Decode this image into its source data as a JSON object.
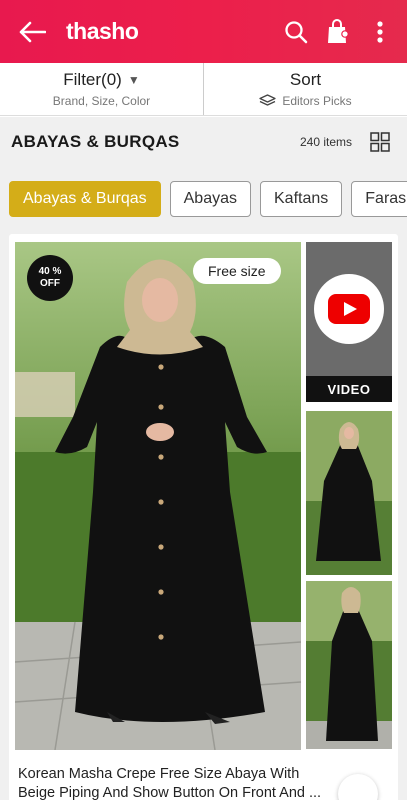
{
  "header": {
    "logo": "thasho",
    "icons": [
      "back-arrow-icon",
      "search-icon",
      "shopping-bag-icon",
      "more-vertical-icon"
    ]
  },
  "filter": {
    "label": "Filter(0)",
    "sub": "Brand, Size, Color"
  },
  "sort": {
    "label": "Sort",
    "sub": "Editors Picks"
  },
  "category": {
    "title": "ABAYAS & BURQAS",
    "count": "240 items"
  },
  "chips": [
    {
      "label": "Abayas & Burqas",
      "active": true
    },
    {
      "label": "Abayas",
      "active": false
    },
    {
      "label": "Kaftans",
      "active": false
    },
    {
      "label": "Farasha",
      "active": false
    }
  ],
  "product": {
    "discount_value": "40 %",
    "discount_label": "OFF",
    "size_tag": "Free size",
    "video_label": "VIDEO",
    "title": "Korean Masha Crepe Free Size Abaya With Beige Piping And Show Button On Front And ..."
  },
  "colors": {
    "brand": "#ec1f4b",
    "chip_active": "#d4ad18"
  }
}
